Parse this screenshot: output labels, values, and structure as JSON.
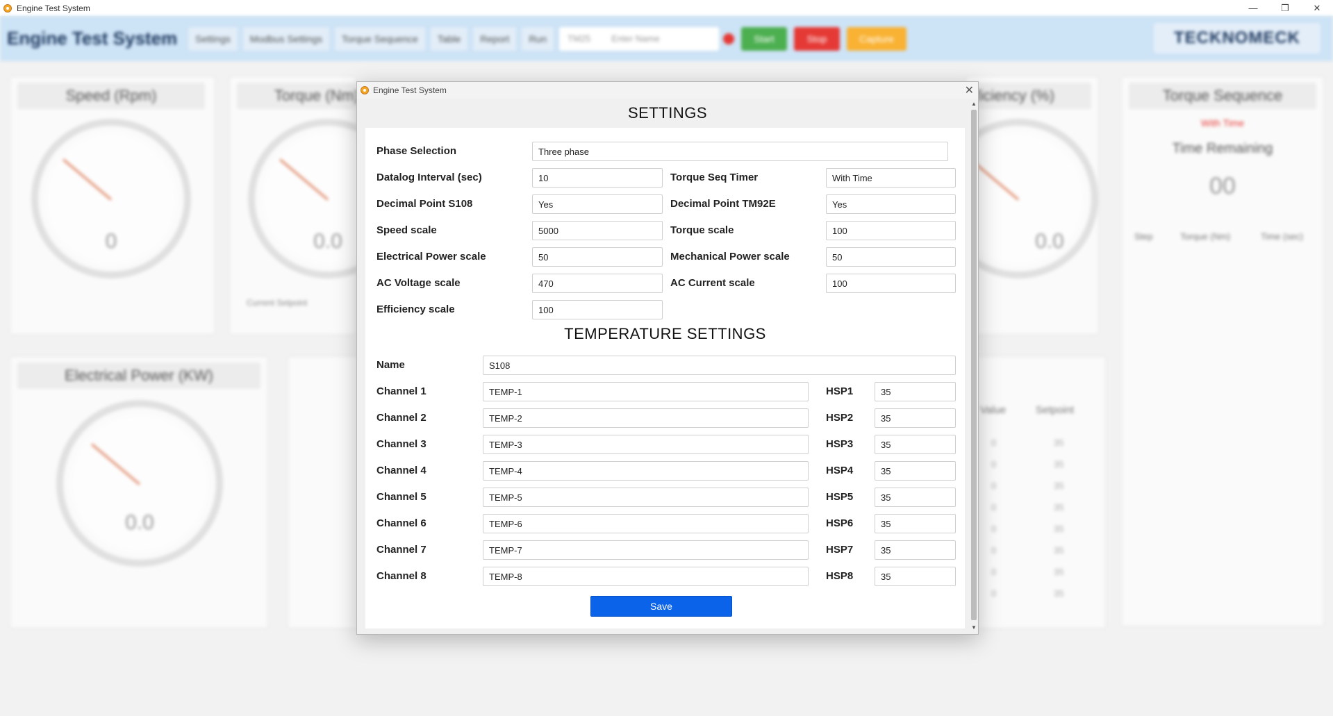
{
  "window": {
    "title": "Engine Test System",
    "controls": {
      "minimize": "—",
      "maximize": "❐",
      "close": "✕"
    }
  },
  "background_app": {
    "app_name": "Engine Test System",
    "toolbar_buttons": [
      "Settings",
      "Modbus Settings",
      "Torque Sequence",
      "Table",
      "Report",
      "Run"
    ],
    "field_label": "TM25",
    "field_placeholder": "Enter Name",
    "start_label": "Start",
    "stop_label": "Stop",
    "capture_label": "Capture",
    "logo_text": "TECKNOMECK",
    "panels": {
      "speed_title": "Speed (Rpm)",
      "speed_value": "0",
      "torque_title": "Torque (Nm)",
      "torque_value": "0.0",
      "torque_setpoint_label": "Current Setpoint",
      "efficiency_title": "Efficiency (%)",
      "efficiency_value": "0.0",
      "elec_power_title": "Electrical Power (KW)",
      "elec_power_value": "0.0",
      "torque_seq_title": "Torque Sequence",
      "torque_seq_mode": "With Time",
      "time_remaining_label": "Time Remaining",
      "time_remaining_value": "00",
      "seq_cols": [
        "Step",
        "Torque (Nm)",
        "Time (sec)"
      ],
      "temp_cols": [
        "Value",
        "Setpoint"
      ],
      "temp_values": [
        "0",
        "0",
        "0",
        "0",
        "0",
        "0",
        "0",
        "0"
      ],
      "temp_setpoints": [
        "35",
        "35",
        "35",
        "35",
        "35",
        "35",
        "35",
        "35"
      ]
    },
    "accent_colors": {
      "toolbar": "#cde3f6",
      "start": "#4caf50",
      "stop": "#e53935",
      "capture": "#f9b233"
    }
  },
  "dialog": {
    "title": "Engine Test System",
    "close": "✕",
    "heading": "SETTINGS",
    "fields": {
      "phase_selection": {
        "label": "Phase Selection",
        "value": "Three phase"
      },
      "datalog_interval": {
        "label": "Datalog Interval (sec)",
        "value": "10"
      },
      "torque_seq_timer": {
        "label": "Torque Seq Timer",
        "value": "With Time"
      },
      "decimal_point_s108": {
        "label": "Decimal Point S108",
        "value": "Yes"
      },
      "decimal_point_tm92e": {
        "label": "Decimal Point TM92E",
        "value": "Yes"
      },
      "speed_scale": {
        "label": "Speed scale",
        "value": "5000"
      },
      "torque_scale": {
        "label": "Torque scale",
        "value": "100"
      },
      "electrical_power_scale": {
        "label": "Electrical Power scale",
        "value": "50"
      },
      "mechanical_power_scale": {
        "label": "Mechanical Power scale",
        "value": "50"
      },
      "ac_voltage_scale": {
        "label": "AC Voltage scale",
        "value": "470"
      },
      "ac_current_scale": {
        "label": "AC Current scale",
        "value": "100"
      },
      "efficiency_scale": {
        "label": "Efficiency scale",
        "value": "100"
      }
    },
    "temperature": {
      "heading": "TEMPERATURE SETTINGS",
      "name_label": "Name",
      "name_value": "S108",
      "channels": [
        {
          "label": "Channel 1",
          "value": "TEMP-1",
          "hsp_label": "HSP1",
          "hsp_value": "35"
        },
        {
          "label": "Channel 2",
          "value": "TEMP-2",
          "hsp_label": "HSP2",
          "hsp_value": "35"
        },
        {
          "label": "Channel 3",
          "value": "TEMP-3",
          "hsp_label": "HSP3",
          "hsp_value": "35"
        },
        {
          "label": "Channel 4",
          "value": "TEMP-4",
          "hsp_label": "HSP4",
          "hsp_value": "35"
        },
        {
          "label": "Channel 5",
          "value": "TEMP-5",
          "hsp_label": "HSP5",
          "hsp_value": "35"
        },
        {
          "label": "Channel 6",
          "value": "TEMP-6",
          "hsp_label": "HSP6",
          "hsp_value": "35"
        },
        {
          "label": "Channel 7",
          "value": "TEMP-7",
          "hsp_label": "HSP7",
          "hsp_value": "35"
        },
        {
          "label": "Channel 8",
          "value": "TEMP-8",
          "hsp_label": "HSP8",
          "hsp_value": "35"
        }
      ]
    },
    "save_label": "Save",
    "save_color": "#0a63e8"
  }
}
